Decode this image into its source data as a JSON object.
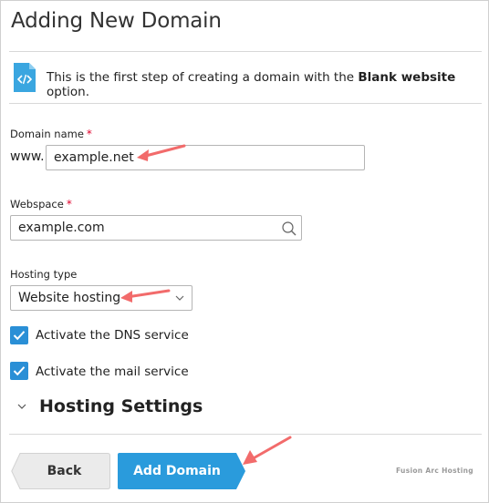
{
  "page": {
    "title": "Adding New Domain"
  },
  "info": {
    "text_before": "This is the first step of creating a domain with the ",
    "text_bold": "Blank website",
    "text_after": " option."
  },
  "domain_name": {
    "label": "Domain name",
    "prefix": "www.",
    "value": "example.net",
    "required_mark": "*"
  },
  "webspace": {
    "label": "Webspace",
    "value": "example.com",
    "required_mark": "*"
  },
  "hosting_type": {
    "label": "Hosting type",
    "selected": "Website hosting"
  },
  "options": {
    "dns": {
      "label": "Activate the DNS service",
      "checked": true
    },
    "mail": {
      "label": "Activate the mail service",
      "checked": true
    }
  },
  "section": {
    "title": "Hosting Settings"
  },
  "buttons": {
    "back": "Back",
    "add": "Add Domain"
  },
  "watermark": "Fusion Arc Hosting",
  "colors": {
    "accent": "#2a9bdc",
    "check": "#2a8fd6",
    "annotation_arrow": "#f26b6b",
    "required": "#e0002a"
  }
}
